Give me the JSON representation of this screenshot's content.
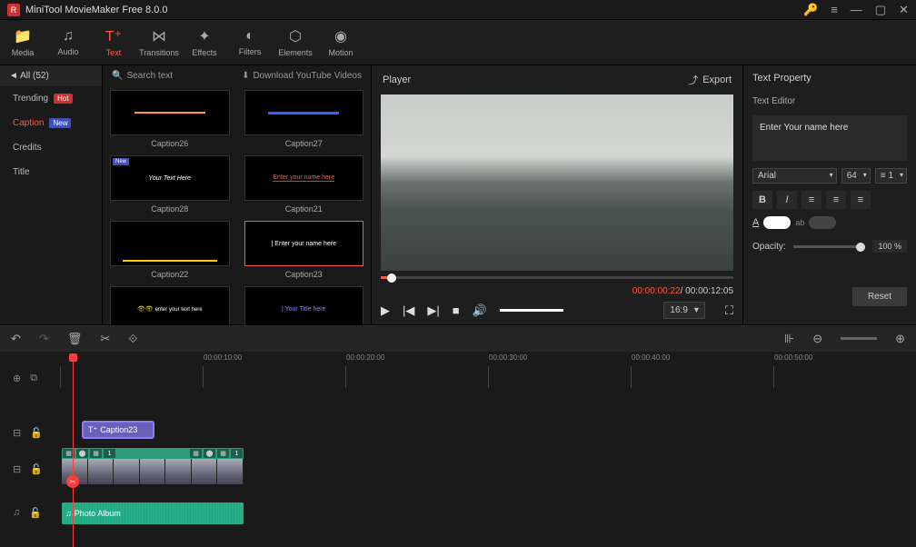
{
  "app": {
    "title": "MiniTool MovieMaker Free 8.0.0"
  },
  "toolbar": {
    "items": [
      {
        "label": "Media"
      },
      {
        "label": "Audio"
      },
      {
        "label": "Text"
      },
      {
        "label": "Transitions"
      },
      {
        "label": "Effects"
      },
      {
        "label": "Filters"
      },
      {
        "label": "Elements"
      },
      {
        "label": "Motion"
      }
    ]
  },
  "sidebar": {
    "header": "All (52)",
    "items": [
      {
        "label": "Trending",
        "badge": "Hot"
      },
      {
        "label": "Caption",
        "badge": "New"
      },
      {
        "label": "Credits"
      },
      {
        "label": "Title"
      }
    ]
  },
  "library": {
    "search": "Search text",
    "download": "Download YouTube Videos",
    "items": [
      {
        "label": "Caption26"
      },
      {
        "label": "Caption27"
      },
      {
        "label": "Caption28"
      },
      {
        "label": "Caption21"
      },
      {
        "label": "Caption22"
      },
      {
        "label": "Caption23"
      },
      {
        "label": ""
      },
      {
        "label": ""
      }
    ]
  },
  "player": {
    "title": "Player",
    "export": "Export",
    "time_current": "00:00:00:22",
    "time_duration": "00:00:12:05",
    "aspect": "16:9"
  },
  "props": {
    "title": "Text Property",
    "editor_label": "Text Editor",
    "text_value": "Enter Your name here",
    "font": "Arial",
    "size": "64",
    "line_spacing": "1",
    "opacity_label": "Opacity:",
    "opacity_value": "100 %",
    "reset": "Reset"
  },
  "timeline": {
    "ruler": [
      "00:00:10:00",
      "00:00:20:00",
      "00:00:30:00",
      "00:00:40:00",
      "00:00:50:00"
    ],
    "text_clip": "Caption23",
    "video_count": "1",
    "audio_clip": "Photo Album"
  }
}
